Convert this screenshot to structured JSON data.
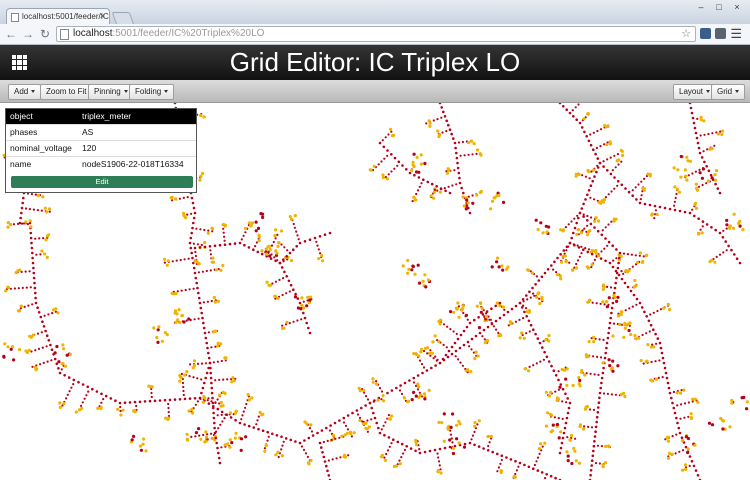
{
  "browser": {
    "tab_title": "localhost:5001/feeder/IC",
    "tab_close": "×",
    "url_host": "localhost",
    "url_path": ":5001/feeder/IC%20Triplex%20LO",
    "window_buttons": [
      "–",
      "□",
      "×"
    ]
  },
  "app": {
    "title": "Grid Editor: IC Triplex LO"
  },
  "toolbar": {
    "add": "Add",
    "zoom_to_fit": "Zoom to Fit",
    "pinning": "Pinning",
    "folding": "Folding",
    "layout": "Layout",
    "grid": "Grid"
  },
  "info_panel": {
    "rows": [
      {
        "key": "object",
        "value": "triplex_meter"
      },
      {
        "key": "phases",
        "value": "AS"
      },
      {
        "key": "nominal_voltage",
        "value": "120"
      },
      {
        "key": "name",
        "value": "nodeS1906-22-018T16334"
      }
    ],
    "edit_label": "Edit"
  },
  "colors": {
    "line_node": "#b5001a",
    "meter_node": "#f0b400",
    "edit_button": "#2f7d57"
  }
}
